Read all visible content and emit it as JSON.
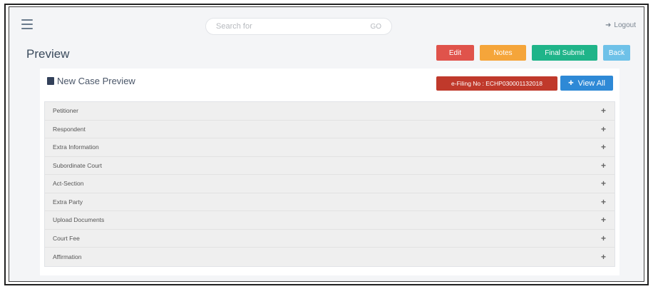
{
  "topbar": {
    "search_placeholder": "Search for",
    "search_go": "GO",
    "logout_icon": "logout-icon",
    "logout_label": "Logout"
  },
  "page": {
    "title": "Preview"
  },
  "actions": {
    "edit": "Edit",
    "notes": "Notes",
    "final_submit": "Final Submit",
    "back": "Back"
  },
  "panel": {
    "title": "New Case Preview",
    "efiling_label": "e-Filing No : ECHP030001132018",
    "view_all": "View All"
  },
  "accordion": [
    {
      "label": "Petitioner"
    },
    {
      "label": "Respondent"
    },
    {
      "label": "Extra Information"
    },
    {
      "label": "Subordinate Court"
    },
    {
      "label": "Act-Section"
    },
    {
      "label": "Extra Party"
    },
    {
      "label": "Upload Documents"
    },
    {
      "label": "Court Fee"
    },
    {
      "label": "Affirmation"
    }
  ],
  "colors": {
    "edit": "#e0534b",
    "notes": "#f5a53a",
    "final_submit": "#1fb489",
    "back": "#6ec1e8",
    "efiling_badge": "#c0392b",
    "view_all": "#2e89d6"
  }
}
